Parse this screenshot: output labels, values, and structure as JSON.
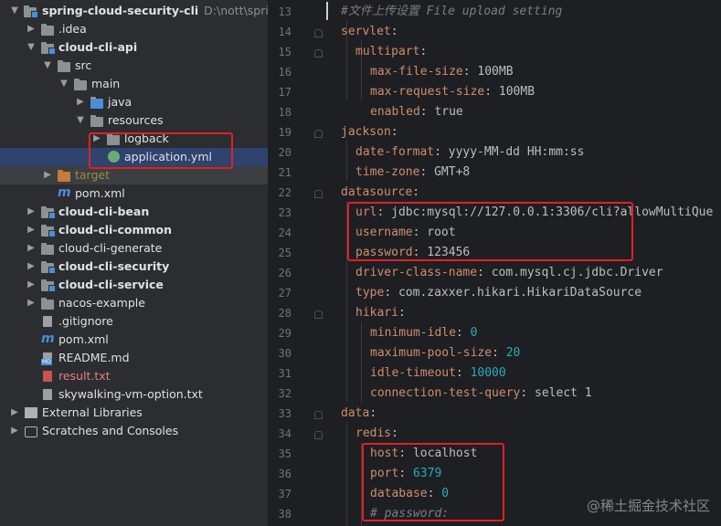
{
  "project_tree": {
    "root": {
      "name": "spring-cloud-security-cli",
      "path": "D:\\nott\\spring-c"
    },
    "items": [
      {
        "label": ".idea"
      },
      {
        "label": "cloud-cli-api"
      },
      {
        "label": "src"
      },
      {
        "label": "main"
      },
      {
        "label": "java"
      },
      {
        "label": "resources"
      },
      {
        "label": "logback"
      },
      {
        "label": "application.yml"
      },
      {
        "label": "target"
      },
      {
        "label": "pom.xml"
      },
      {
        "label": "cloud-cli-bean"
      },
      {
        "label": "cloud-cli-common"
      },
      {
        "label": "cloud-cli-generate"
      },
      {
        "label": "cloud-cli-security"
      },
      {
        "label": "cloud-cli-service"
      },
      {
        "label": "nacos-example"
      },
      {
        "label": ".gitignore"
      },
      {
        "label": "pom.xml"
      },
      {
        "label": "README.md"
      },
      {
        "label": "result.txt"
      },
      {
        "label": "skywalking-vm-option.txt"
      },
      {
        "label": "External Libraries"
      },
      {
        "label": "Scratches and Consoles"
      }
    ]
  },
  "editor": {
    "lines": [
      {
        "num": "13",
        "text": "#文件上传设置 File upload setting"
      },
      {
        "num": "14",
        "key": "servlet",
        "rest": ":"
      },
      {
        "num": "15",
        "key": "multipart",
        "rest": ":"
      },
      {
        "num": "16",
        "key": "max-file-size",
        "rest": ": 100MB"
      },
      {
        "num": "17",
        "key": "max-request-size",
        "rest": ": 100MB"
      },
      {
        "num": "18",
        "key": "enabled",
        "rest": ": true"
      },
      {
        "num": "19",
        "key": "jackson",
        "rest": ":"
      },
      {
        "num": "20",
        "key": "date-format",
        "rest": ": yyyy-MM-dd HH:mm:ss"
      },
      {
        "num": "21",
        "key": "time-zone",
        "rest": ": GMT+8"
      },
      {
        "num": "22",
        "key": "datasource",
        "rest": ":"
      },
      {
        "num": "23",
        "key": "url",
        "rest": ": jdbc:mysql://127.0.0.1:3306/cli?allowMultiQue"
      },
      {
        "num": "24",
        "key": "username",
        "rest": ": root"
      },
      {
        "num": "25",
        "key": "password",
        "rest": ": 123456"
      },
      {
        "num": "26",
        "key": "driver-class-name",
        "rest": ": com.mysql.cj.jdbc.Driver"
      },
      {
        "num": "27",
        "key": "type",
        "rest": ": com.zaxxer.hikari.HikariDataSource"
      },
      {
        "num": "28",
        "key": "hikari",
        "rest": ":"
      },
      {
        "num": "29",
        "key": "minimum-idle",
        "rest": ": ",
        "num_val": "0"
      },
      {
        "num": "30",
        "key": "maximum-pool-size",
        "rest": ": ",
        "num_val": "20"
      },
      {
        "num": "31",
        "key": "idle-timeout",
        "rest": ": ",
        "num_val": "10000"
      },
      {
        "num": "32",
        "key": "connection-test-query",
        "rest": ": select 1"
      },
      {
        "num": "33",
        "key": "data",
        "rest": ":"
      },
      {
        "num": "34",
        "key": "redis",
        "rest": ":"
      },
      {
        "num": "35",
        "key": "host",
        "rest": ": localhost"
      },
      {
        "num": "36",
        "key": "port",
        "rest": ": ",
        "num_val": "6379"
      },
      {
        "num": "37",
        "key": "database",
        "rest": ": ",
        "num_val": "0"
      },
      {
        "num": "38",
        "text": "# password:"
      }
    ]
  },
  "watermark": "@稀土掘金技术社区",
  "colors": {
    "highlight_box": "#e0202a",
    "key": "#cf8e6d",
    "number": "#2aacb8",
    "comment": "#7a7e85",
    "selection": "#2e436e"
  }
}
